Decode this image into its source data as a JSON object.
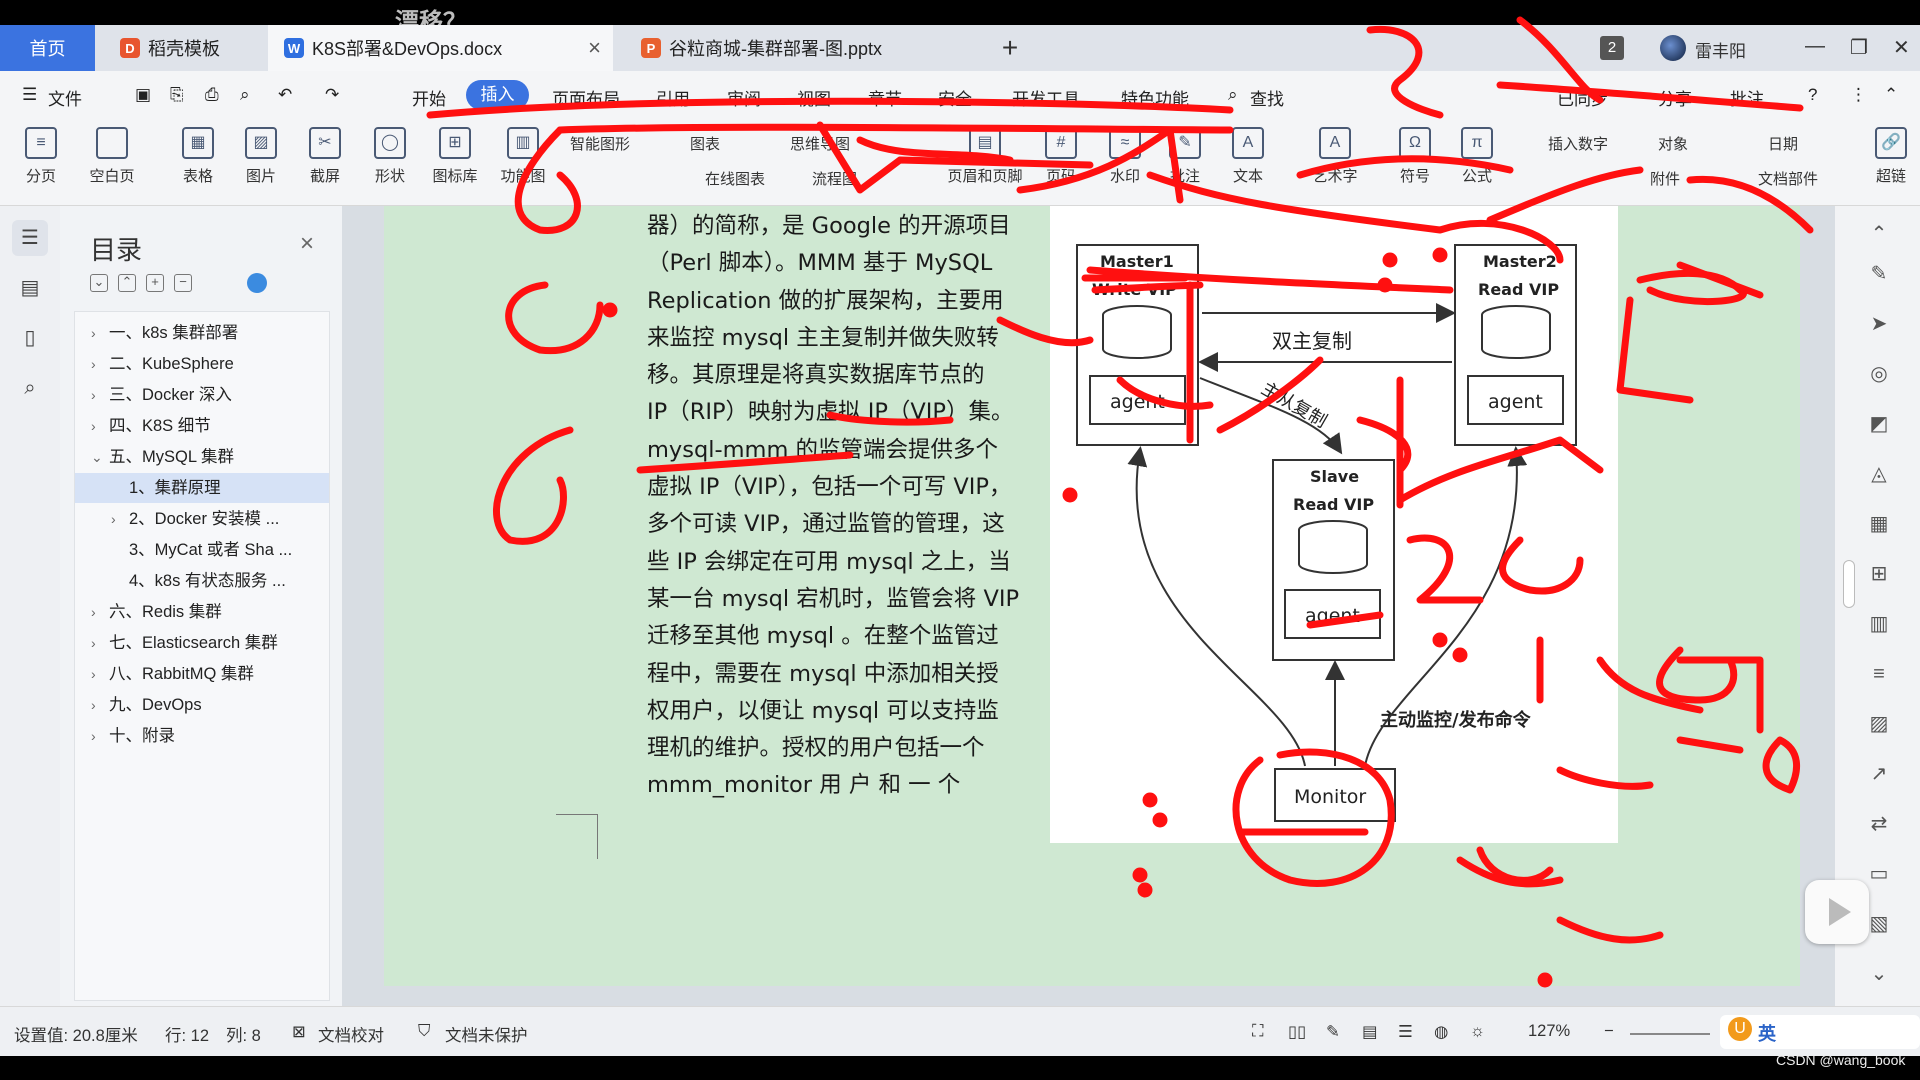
{
  "overlay_text": "漂移？",
  "tabs": {
    "home": "首页",
    "templates": "稻壳模板",
    "doc": "K8S部署&DevOps.docx",
    "ppt": "谷粒商城-集群部署-图.pptx"
  },
  "window": {
    "badge": "2",
    "user": "雷丰阳"
  },
  "menu": {
    "file": "文件",
    "items": [
      "开始",
      "插入",
      "页面布局",
      "引用",
      "审阅",
      "视图",
      "章节",
      "安全",
      "开发工具",
      "特色功能"
    ],
    "search": "查找",
    "synced": "已同步",
    "share": "分享",
    "comment": "批注"
  },
  "ribbon": {
    "large": [
      "分页",
      "空白页",
      "表格",
      "图片",
      "截屏",
      "形状",
      "图标库",
      "功能图",
      "页眉和页脚",
      "页码",
      "水印",
      "批注",
      "文本",
      "艺术字",
      "符号",
      "公式",
      "超链"
    ],
    "small": [
      "智能图形",
      "图表",
      "思维导图",
      "在线图表",
      "流程图",
      "插入数字",
      "对象",
      "日期",
      "附件",
      "文档部件"
    ]
  },
  "toc": {
    "title": "目录",
    "items": [
      {
        "label": "一、k8s 集群部署",
        "arrow": "›"
      },
      {
        "label": "二、KubeSphere",
        "arrow": "›"
      },
      {
        "label": "三、Docker 深入",
        "arrow": "›"
      },
      {
        "label": "四、K8S 细节",
        "arrow": "›"
      },
      {
        "label": "五、MySQL 集群",
        "arrow": "⌄"
      },
      {
        "label": "1、集群原理",
        "arrow": ""
      },
      {
        "label": "2、Docker 安装模 ...",
        "arrow": "›"
      },
      {
        "label": "3、MyCat 或者 Sha ...",
        "arrow": ""
      },
      {
        "label": "4、k8s 有状态服务 ...",
        "arrow": ""
      },
      {
        "label": "六、Redis 集群",
        "arrow": "›"
      },
      {
        "label": "七、Elasticsearch 集群",
        "arrow": "›"
      },
      {
        "label": "八、RabbitMQ 集群",
        "arrow": "›"
      },
      {
        "label": "九、DevOps",
        "arrow": "›"
      },
      {
        "label": "十、附录",
        "arrow": "›"
      }
    ]
  },
  "doc": {
    "lines": [
      "器）的简称，是 Google 的开源项目",
      "（Perl 脚本）。MMM 基于 MySQL",
      "Replication 做的扩展架构，主要用",
      "来监控 mysql 主主复制并做失败转",
      "移。其原理是将真实数据库节点的",
      "IP（RIP）映射为虚拟 IP（VIP）集。",
      "mysql-mmm 的监管端会提供多个",
      "虚拟 IP（VIP），包括一个可写 VIP，",
      "多个可读 VIP，通过监管的管理，这",
      "些 IP 会绑定在可用 mysql 之上，当",
      "某一台 mysql 宕机时，监管会将 VIP",
      "迁移至其他 mysql 。在整个监管过",
      "程中，需要在 mysql 中添加相关授",
      "权用户，以便让 mysql 可以支持监",
      "理机的维护。授权的用户包括一个",
      "mmm_monitor  用  户  和  一  个"
    ]
  },
  "diagram": {
    "master1_title": "Master1",
    "master1_vip": "Write VIP",
    "master2_title": "Master2",
    "master2_vip": "Read VIP",
    "slave_title": "Slave",
    "slave_vip": "Read VIP",
    "agent": "agent",
    "dual_master": "双主复制",
    "master_slave": "主从复制",
    "monitor": "Monitor",
    "monitor_cmd": "主动监控/发布命令"
  },
  "status": {
    "setting": "设置值: 20.8厘米",
    "row": "行: 12",
    "col": "列: 8",
    "proof": "文档校对",
    "protect": "文档未保护",
    "zoom": "127%",
    "ime": "英"
  },
  "watermark": "CSDN @wang_book",
  "colors": {
    "accent": "#3b73e0",
    "page": "#cfe8d2",
    "ink": "#ff0000"
  }
}
